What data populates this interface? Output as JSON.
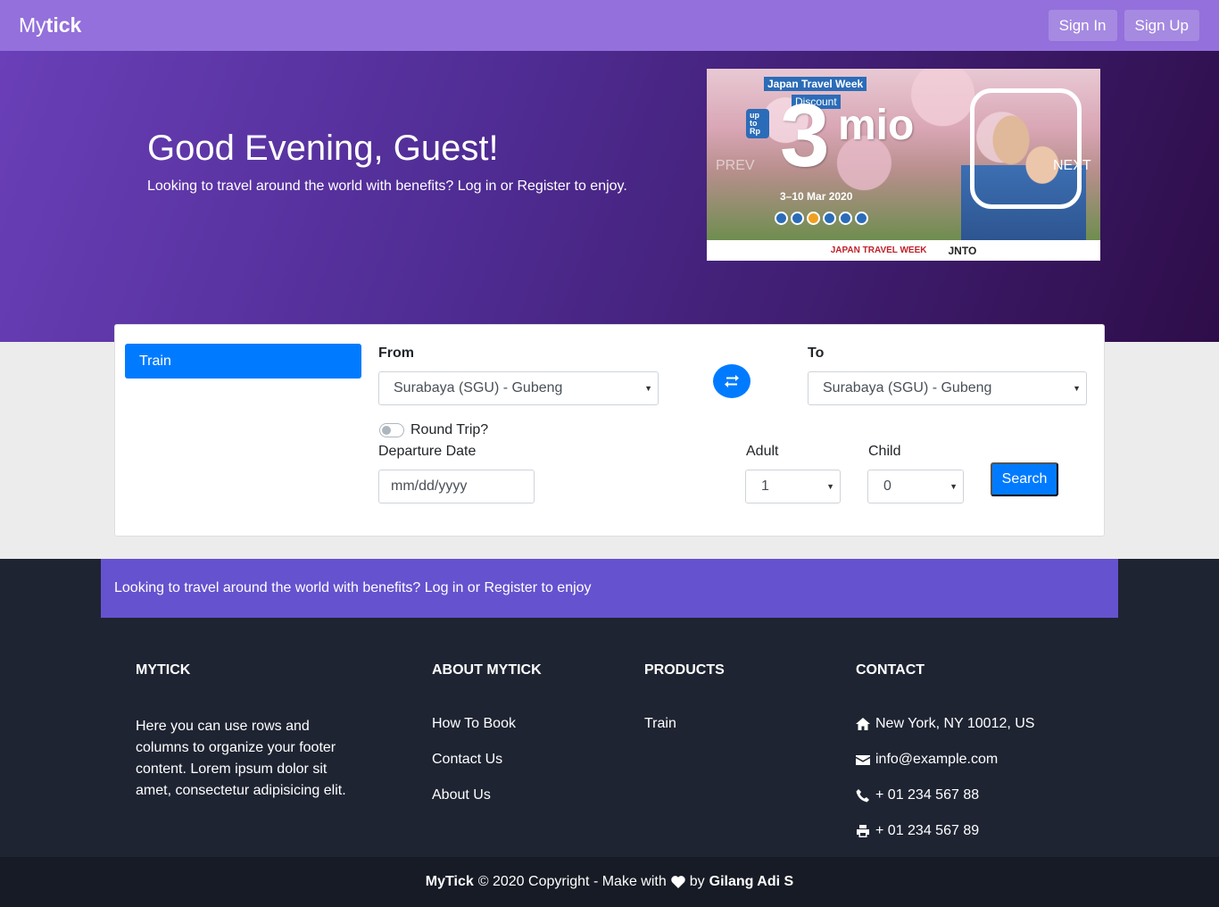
{
  "nav": {
    "brand_prefix": "My",
    "brand_suffix": "tick",
    "sign_in": "Sign In",
    "sign_up": "Sign Up"
  },
  "hero": {
    "title": "Good Evening, Guest!",
    "subtitle": "Looking to travel around the world with benefits? Log in or Register to enjoy."
  },
  "carousel": {
    "prev": "PREV",
    "next": "NEXT",
    "banner": {
      "title": "Japan Travel Week",
      "discount": "Discount",
      "upto": "up to Rp",
      "amount": "3",
      "unit": "mio",
      "dates": "3–10 Mar 2020",
      "logo1": "JAPAN TRAVEL WEEK",
      "logo2": "JNTO"
    }
  },
  "search": {
    "tab": "Train",
    "from_label": "From",
    "from_value": "Surabaya (SGU) - Gubeng",
    "to_label": "To",
    "to_value": "Surabaya (SGU) - Gubeng",
    "swap_icon": "swap-arrows-icon",
    "round_trip": "Round Trip?",
    "round_trip_checked": false,
    "departure_label": "Departure Date",
    "departure_placeholder": "mm/dd/yyyy",
    "adult_label": "Adult",
    "adult_value": "1",
    "child_label": "Child",
    "child_value": "0",
    "search_button": "Search"
  },
  "promo": "Looking to travel around the world with benefits? Log in or Register to enjoy",
  "footer": {
    "col1_title": "MYTICK",
    "col1_text": "Here you can use rows and columns to organize your footer content. Lorem ipsum dolor sit amet, consectetur adipisicing elit.",
    "col2_title": "ABOUT MYTICK",
    "col2_links": [
      "How To Book",
      "Contact Us",
      "About Us"
    ],
    "col3_title": "PRODUCTS",
    "col3_links": [
      "Train"
    ],
    "col4_title": "CONTACT",
    "contact": {
      "address": "New York, NY 10012, US",
      "email": "info@example.com",
      "phone": "+ 01 234 567 88",
      "fax": "+ 01 234 567 89"
    }
  },
  "copyright": {
    "brand": "MyTick",
    "text": "© 2020 Copyright - Make with",
    "by": "by",
    "author": "Gilang Adi S"
  },
  "colors": {
    "navbar": "#9370db",
    "primary": "#007bff",
    "promo": "#6552cf",
    "footer": "#1e2432"
  }
}
